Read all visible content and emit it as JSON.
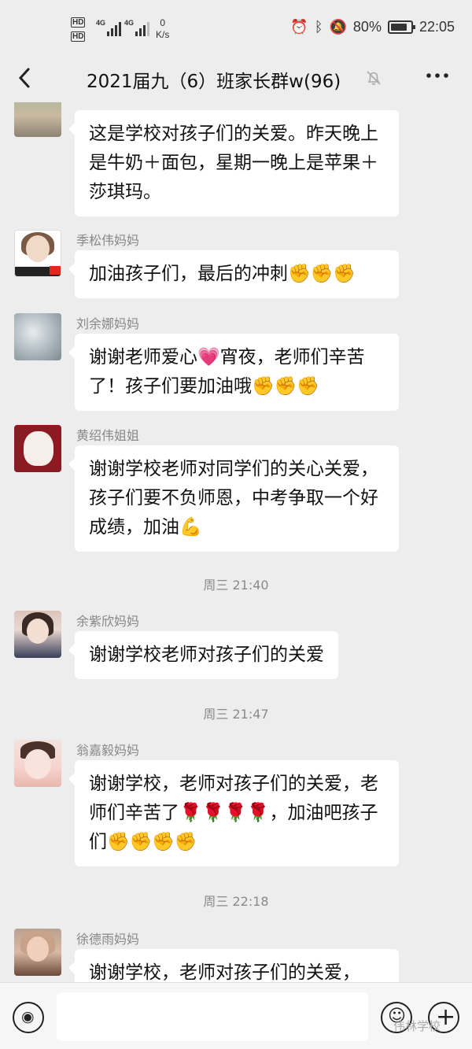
{
  "status_bar": {
    "hd_label_1": "HD",
    "hd_label_2": "HD",
    "signal_1": "4G",
    "signal_2": "4G",
    "speed_value": "0",
    "speed_unit": "K/s",
    "battery_percent": "80%",
    "time": "22:05",
    "icons": [
      "alarm-icon",
      "bluetooth-icon",
      "mute-icon",
      "battery-icon"
    ]
  },
  "header": {
    "title": "2021届九（6）班家长群w(96)",
    "icons": [
      "back-icon",
      "muted-bell-icon",
      "more-icon"
    ]
  },
  "messages": [
    {
      "sender": "",
      "text": "这是学校对孩子们的关爱。昨天晚上是牛奶＋面包，星期一晚上是苹果＋莎琪玛。"
    },
    {
      "sender": "季松伟妈妈",
      "text": "加油孩子们，最后的冲刺✊✊✊"
    },
    {
      "sender": "刘余娜妈妈",
      "text": "谢谢老师爱心💗宵夜，老师们辛苦了！孩子们要加油哦✊✊✊"
    },
    {
      "sender": "黄绍伟姐姐",
      "text": "谢谢学校老师对同学们的关心关爱，孩子们要不负师恩，中考争取一个好成绩，加油💪"
    },
    {
      "sender": "余紫欣妈妈",
      "text": "谢谢学校老师对孩子们的关爱"
    },
    {
      "sender": "翁嘉毅妈妈",
      "text": "谢谢学校，老师对孩子们的关爱，老师们辛苦了🌹🌹🌹🌹，加油吧孩子们✊✊✊✊"
    },
    {
      "sender": "徐德雨妈妈",
      "text": "谢谢学校，老师对孩子们的关爱，"
    }
  ],
  "timestamps": [
    "周三 21:40",
    "周三 21:47",
    "周三 22:18"
  ],
  "bottom_bar": {
    "input_value": "",
    "icons": [
      "voice-icon",
      "emoji-icon",
      "plus-icon"
    ]
  },
  "watermark": "伟林学校"
}
